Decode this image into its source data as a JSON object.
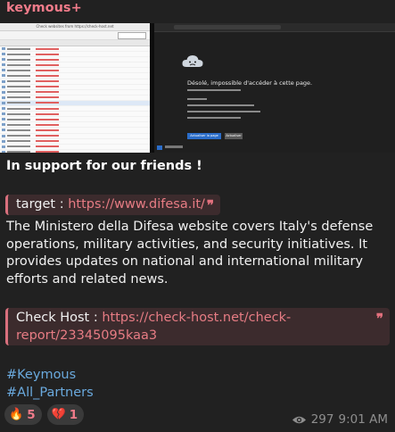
{
  "sender": {
    "name": "keymous+"
  },
  "media": {
    "left_screenshot": {
      "window_title": "Check websites from https://check-host.net"
    },
    "right_screenshot": {
      "error_title": "Désolé, impossible d'accéder à cette page.",
      "primary_button": "Actualiser la page",
      "secondary_button": "Actualiser"
    }
  },
  "intro": "In support for our friends !",
  "target_quote": {
    "label": "target : ",
    "link": "https://www.difesa.it/"
  },
  "description": "The Ministero della Difesa website covers Italy's defense operations, military activities, and security initiatives. It provides updates on national and international military efforts and related news.",
  "check_quote": {
    "label": "Check Host : ",
    "link": "https://check-host.net/check-report/23345095kaa3"
  },
  "hashtags": [
    "#Keymous",
    "#All_Partners"
  ],
  "reactions": [
    {
      "emoji": "🔥",
      "icon": "fire-icon",
      "count": "5"
    },
    {
      "emoji": "💔",
      "icon": "broken-heart-icon",
      "count": "1"
    }
  ],
  "meta": {
    "views": "297",
    "time": "9:01 AM"
  },
  "colors": {
    "accent": "#f07b8a",
    "link": "#e77c84",
    "hashtag": "#6aa9dd",
    "quote_bg": "#3c2b2d"
  }
}
